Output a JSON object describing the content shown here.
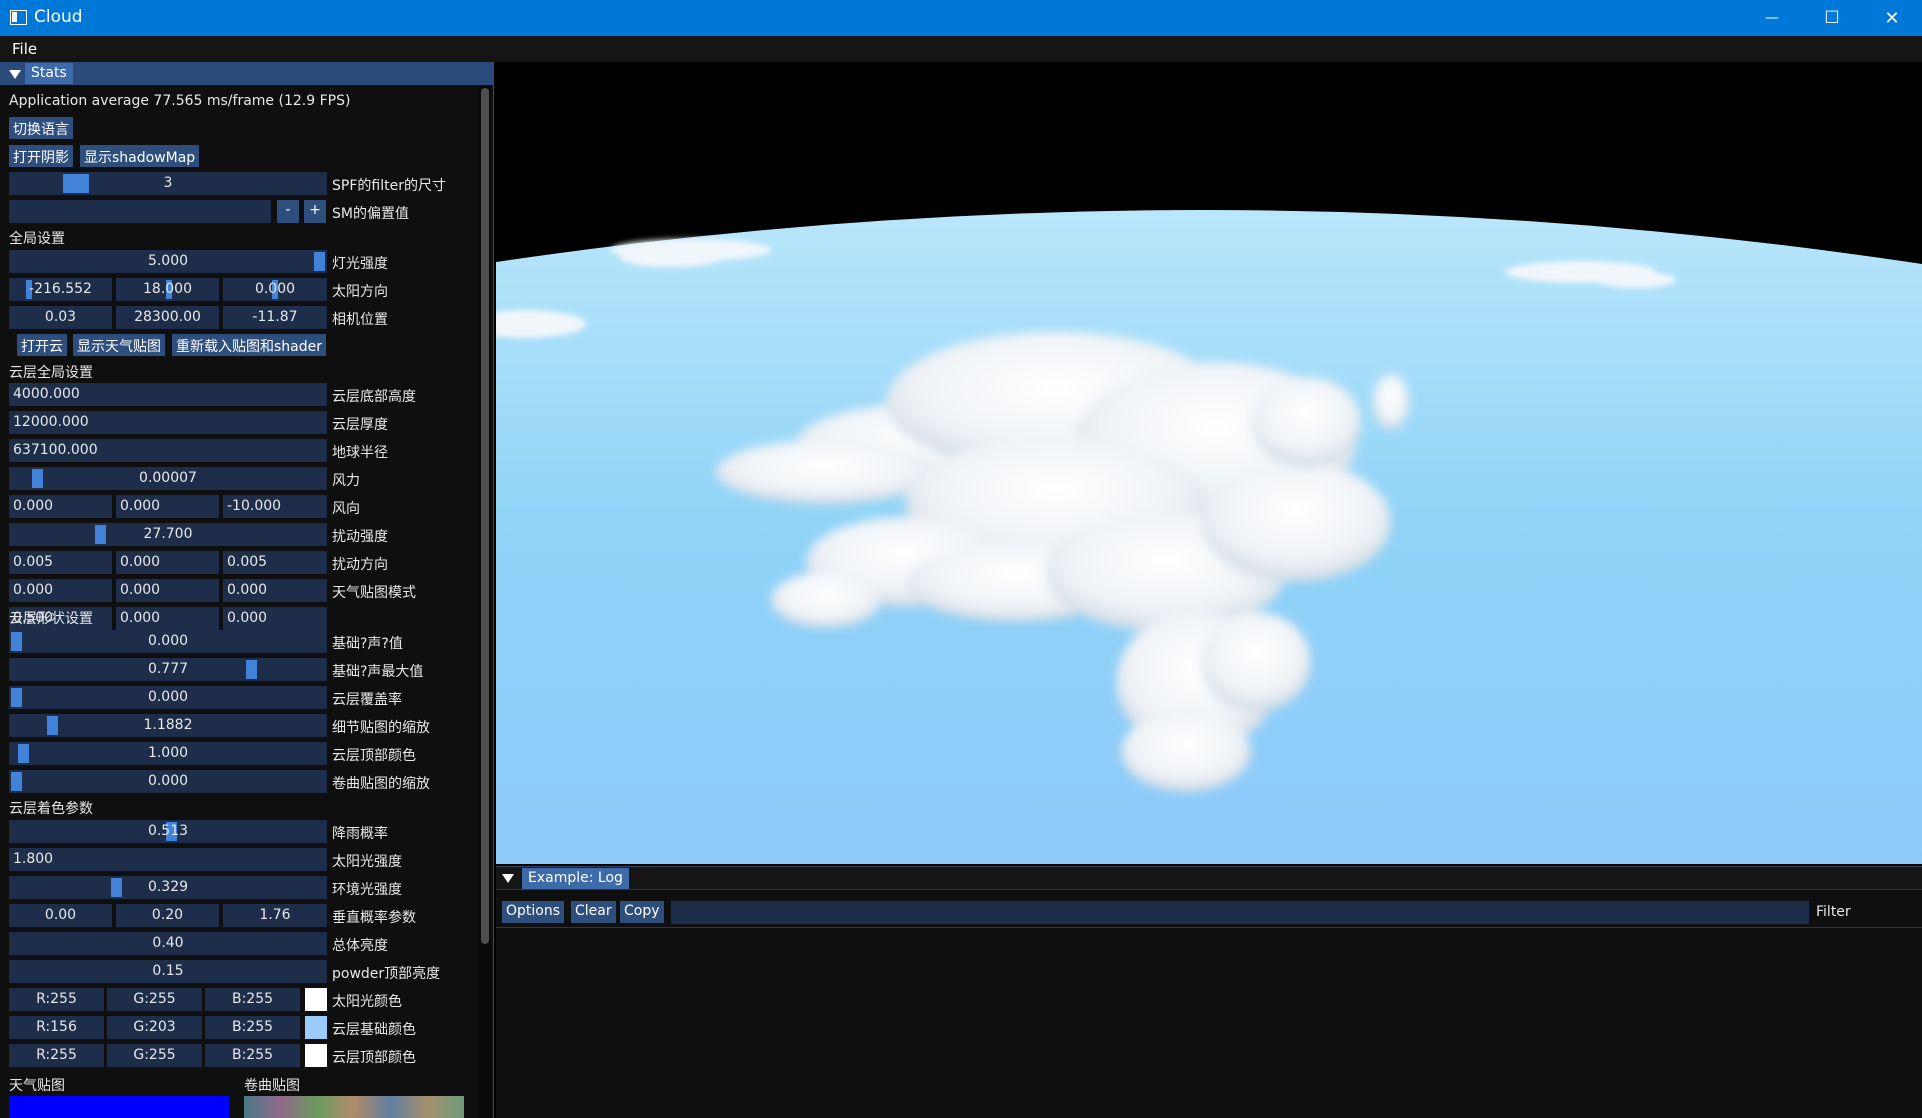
{
  "window": {
    "title": "Cloud",
    "minimize": "—",
    "maximize": "☐",
    "close": "✕"
  },
  "menu": {
    "file": "File"
  },
  "stats_panel": {
    "tab": "Stats",
    "app_average": "Application average 77.565 ms/frame (12.9 FPS)",
    "switch_language": "切换语言",
    "open_shadow": "打开阴影",
    "show_shadowmap": "显示shadowMap",
    "spf_filter": {
      "value": "3",
      "label": "SPF的filter的尺寸",
      "fraction": 0.2
    },
    "sm_bias": {
      "value": "",
      "label": "SM的偏置值",
      "minus": "-",
      "plus": "+"
    },
    "global_header": "全局设置",
    "light_intensity": {
      "value": "5.000",
      "label": "灯光强度",
      "fraction": 1.0
    },
    "sun_direction": {
      "x": "-216.552",
      "y": "18.000",
      "z": "0.000",
      "label": "太阳方向"
    },
    "camera_position": {
      "x": "0.03",
      "y": "28300.00",
      "z": "-11.87",
      "label": "相机位置"
    },
    "open_cloud": "打开云",
    "show_weather_map": "显示天气贴图",
    "reload": "重新载入贴图和shader",
    "cloud_global_header": "云层全局设置",
    "cloud_bottom_height": {
      "value": "4000.000",
      "label": "云层底部高度"
    },
    "cloud_thickness": {
      "value": "12000.000",
      "label": "云层厚度"
    },
    "earth_radius": {
      "value": "637100.000",
      "label": "地球半径"
    },
    "wind_strength": {
      "value": "0.00007",
      "label": "风力",
      "fraction": 0.07
    },
    "wind_direction": {
      "x": "0.000",
      "y": "0.000",
      "z": "-10.000",
      "label": "风向"
    },
    "disturb_strength": {
      "value": "27.700",
      "label": "扰动强度",
      "fraction": 0.28
    },
    "disturb_direction": {
      "x": "0.005",
      "y": "0.000",
      "z": "0.005",
      "label": "扰动方向"
    },
    "weather_map_mode": {
      "x": "0.000",
      "y": "0.000",
      "z": "0.000",
      "label": "天气贴图模式"
    },
    "weather_row_values": {
      "x": "0.500",
      "y": "0.000",
      "z": "0.000"
    },
    "cloud_shape_header": "云层形状设置",
    "base_noise_value": {
      "value": "0.000",
      "label": "基础?声?值",
      "fraction": 0.0
    },
    "base_noise_max": {
      "value": "0.777",
      "label": "基础?声最大值",
      "fraction": 0.777
    },
    "cloud_coverage": {
      "value": "0.000",
      "label": "云层覆盖率",
      "fraction": 0.0
    },
    "detail_scale": {
      "value": "1.1882",
      "label": "细节贴图的缩放",
      "fraction": 0.12
    },
    "cloud_top_color": {
      "value": "1.000",
      "label": "云层顶部颜色",
      "fraction": 0.02
    },
    "curl_scale": {
      "value": "0.000",
      "label": "卷曲贴图的缩放",
      "fraction": 0.0
    },
    "cloud_shading_header": "云层着色参数",
    "rain_probability": {
      "value": "0.513",
      "label": "降雨概率",
      "fraction": 0.513
    },
    "sun_intensity": {
      "value": "1.800",
      "label": "太阳光强度"
    },
    "ambient_intensity": {
      "value": "0.329",
      "label": "环境光强度",
      "fraction": 0.329
    },
    "vertical_prob": {
      "x": "0.00",
      "y": "0.20",
      "z": "1.76",
      "label": "垂直概率参数"
    },
    "overall_brightness": {
      "value": "0.40",
      "label": "总体亮度"
    },
    "powder_top": {
      "value": "0.15",
      "label": "powder顶部亮度"
    },
    "sun_color": {
      "r": "R:255",
      "g": "G:255",
      "b": "B:255",
      "label": "太阳光颜色",
      "color": "#ffffff"
    },
    "cloud_base_color": {
      "r": "R:156",
      "g": "G:203",
      "b": "B:255",
      "label": "云层基础颜色",
      "color": "#9ccbff"
    },
    "cloud_top_rgb": {
      "r": "R:255",
      "g": "G:255",
      "b": "B:255",
      "label": "云层顶部颜色",
      "color": "#ffffff"
    },
    "weather_map_label": "天气贴图",
    "curl_map_label": "卷曲贴图"
  },
  "log_panel": {
    "tab": "Example: Log",
    "options": "Options",
    "clear": "Clear",
    "copy": "Copy",
    "filter_value": "",
    "filter_label": "Filter"
  },
  "colors": {
    "accent": "#0078d7",
    "slider_grab": "#4282d9",
    "frame_bg": "#1e2e4a",
    "button": "#2e4f7d",
    "sky": "#7fcdf5"
  }
}
